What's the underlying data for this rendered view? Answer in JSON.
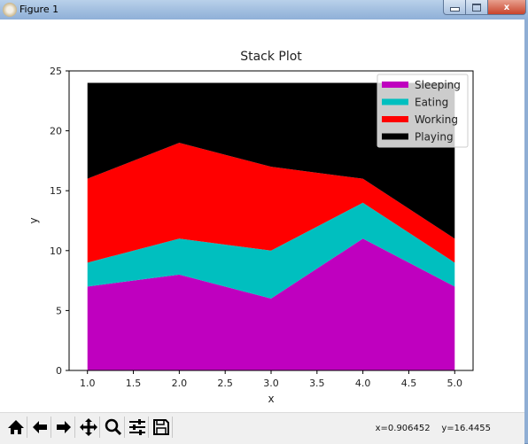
{
  "window": {
    "title": "Figure 1",
    "minimize_label": "",
    "maximize_label": "",
    "close_label": "x"
  },
  "toolbar": {
    "buttons": [
      {
        "name": "home",
        "icon": "home-icon"
      },
      {
        "name": "back",
        "icon": "arrow-left-icon"
      },
      {
        "name": "forward",
        "icon": "arrow-right-icon"
      },
      {
        "name": "pan",
        "icon": "move-icon"
      },
      {
        "name": "zoom",
        "icon": "zoom-icon"
      },
      {
        "name": "configure-subplots",
        "icon": "sliders-icon"
      },
      {
        "name": "save",
        "icon": "floppy-disk-icon"
      }
    ],
    "coords_x": "x=0.906452",
    "coords_y": "y=16.4455"
  },
  "chart_data": {
    "type": "area",
    "stacked": true,
    "title": "Stack Plot",
    "xlabel": "x",
    "ylabel": "y",
    "x": [
      1,
      2,
      3,
      4,
      5
    ],
    "series": [
      {
        "name": "Sleeping",
        "color": "#bf00bf",
        "values": [
          7,
          8,
          6,
          11,
          7
        ]
      },
      {
        "name": "Eating",
        "color": "#00bfbf",
        "values": [
          2,
          3,
          4,
          3,
          2
        ]
      },
      {
        "name": "Working",
        "color": "#ff0000",
        "values": [
          7,
          8,
          7,
          2,
          2
        ]
      },
      {
        "name": "Playing",
        "color": "#000000",
        "values": [
          8,
          5,
          7,
          8,
          13
        ]
      }
    ],
    "xlim": [
      0.8,
      5.2
    ],
    "ylim": [
      0,
      25
    ],
    "xticks": [
      "1.0",
      "1.5",
      "2.0",
      "2.5",
      "3.0",
      "3.5",
      "4.0",
      "4.5",
      "5.0"
    ],
    "xtick_values": [
      1.0,
      1.5,
      2.0,
      2.5,
      3.0,
      3.5,
      4.0,
      4.5,
      5.0
    ],
    "yticks": [
      "0",
      "5",
      "10",
      "15",
      "20",
      "25"
    ],
    "ytick_values": [
      0,
      5,
      10,
      15,
      20,
      25
    ],
    "grid": false,
    "legend_position": "top-right"
  }
}
